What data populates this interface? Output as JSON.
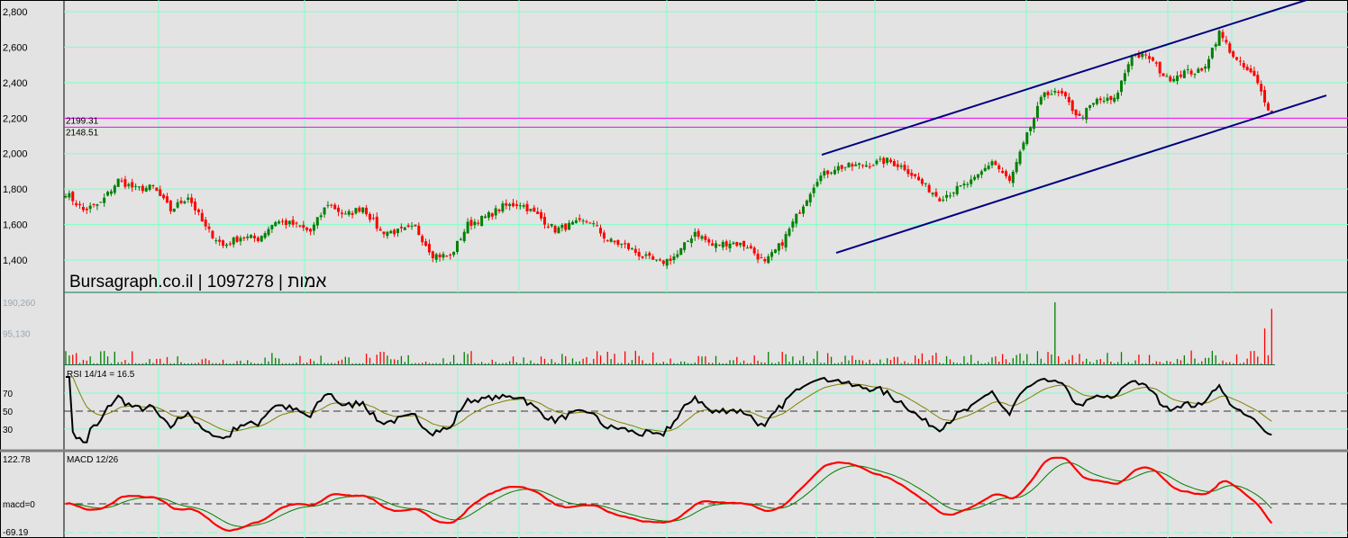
{
  "chart_data": {
    "type": "candlestick",
    "title": "Bursagraph.co.il | 1097278 | אמות",
    "price_axis": {
      "ticks": [
        "2,800",
        "2,600",
        "2,400",
        "2,200",
        "2,000",
        "1,800",
        "1,600",
        "1,400"
      ],
      "tick_values": [
        2800,
        2600,
        2400,
        2200,
        2000,
        1800,
        1600,
        1400
      ],
      "ylim": [
        1340,
        2870
      ]
    },
    "grid": true,
    "close_path": [
      1780,
      1680,
      1720,
      1850,
      1800,
      1810,
      1680,
      1760,
      1580,
      1480,
      1530,
      1520,
      1620,
      1600,
      1560,
      1720,
      1650,
      1700,
      1560,
      1560,
      1580,
      1430,
      1420,
      1600,
      1640,
      1700,
      1720,
      1650,
      1570,
      1600,
      1620,
      1510,
      1480,
      1420,
      1380,
      1430,
      1560,
      1480,
      1500,
      1480,
      1380,
      1500,
      1680,
      1860,
      1920,
      1930,
      1940,
      1960,
      1920,
      1830,
      1750,
      1800,
      1850,
      1960,
      1840,
      2100,
      2350,
      2330,
      2200,
      2300,
      2300,
      2560,
      2540,
      2420,
      2460,
      2460,
      2680,
      2520,
      2430,
      2220
    ],
    "horizontal_lines": [
      {
        "label": "2199.31",
        "value": 2199.31,
        "color": "#ff00ff"
      },
      {
        "label": "2148.51",
        "value": 2148.51,
        "color": "#ff00ff"
      }
    ],
    "trend_channel": {
      "upper": {
        "from_value": 1993,
        "to_value": 2866
      },
      "lower": {
        "from_value": 1440,
        "to_value": 2328
      },
      "color": "#00007f"
    },
    "volume": {
      "ticks": [
        "190,260",
        "95,130"
      ],
      "tick_values": [
        190260,
        95130
      ],
      "spikes": [
        {
          "position_fraction": 0.82,
          "value": 190260
        },
        {
          "position_fraction": 1.0,
          "value": 170000
        }
      ]
    },
    "rsi": {
      "label": "RSI 14/14 = 16.5",
      "period": 14,
      "value": 16.5,
      "ticks": [
        "70",
        "50",
        "30"
      ],
      "tick_values": [
        70,
        50,
        30
      ]
    },
    "macd": {
      "label": "MACD 12/26",
      "ticks": [
        "122.78",
        "macd=0",
        "-69.19"
      ],
      "tick_values": [
        122.78,
        0,
        -69.19
      ]
    },
    "colors": {
      "up": "#008000",
      "down": "#ff0000",
      "grid": "#80ffc8",
      "background": "#e3e3e3",
      "rsi_line": "#000000",
      "rsi_signal": "#808000",
      "macd_line": "#ff0000",
      "macd_signal": "#008000"
    }
  }
}
